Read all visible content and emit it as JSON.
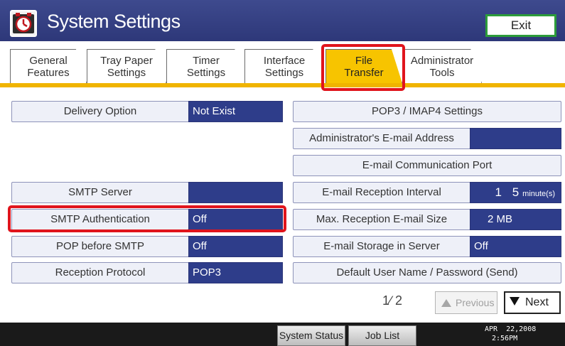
{
  "window": {
    "title": "System Settings",
    "exit_label": "Exit"
  },
  "tabs": [
    {
      "line1": "General",
      "line2": "Features",
      "active": false
    },
    {
      "line1": "Tray Paper",
      "line2": "Settings",
      "active": false
    },
    {
      "line1": "Timer",
      "line2": "Settings",
      "active": false
    },
    {
      "line1": "Interface",
      "line2": "Settings",
      "active": false
    },
    {
      "line1": "File",
      "line2": "Transfer",
      "active": true
    },
    {
      "line1": "Administrator",
      "line2": "Tools",
      "active": false
    }
  ],
  "left_settings": [
    {
      "label": "Delivery Option",
      "value": "Not Exist"
    },
    {
      "label": "SMTP Server",
      "value": ""
    },
    {
      "label": "SMTP Authentication",
      "value": "Off"
    },
    {
      "label": "POP before SMTP",
      "value": "Off"
    },
    {
      "label": "Reception Protocol",
      "value": "POP3"
    }
  ],
  "right_settings": [
    {
      "label": "POP3 / IMAP4 Settings"
    },
    {
      "label": "Administrator's E-mail Address",
      "value": ""
    },
    {
      "label": "E-mail Communication Port"
    },
    {
      "label": "E-mail Reception Interval",
      "value": "1 5",
      "unit": "minute(s)"
    },
    {
      "label": "Max. Reception E-mail Size",
      "value": "2 MB"
    },
    {
      "label": "E-mail Storage in Server",
      "value": "Off"
    },
    {
      "label": "Default User Name / Password (Send)"
    }
  ],
  "paging": {
    "indicator": "1∕ 2",
    "previous_label": "Previous",
    "next_label": "Next",
    "current": 1,
    "total": 2
  },
  "bottom": {
    "system_status_label": "System Status",
    "job_list_label": "Job List",
    "date": "APR  22,2008",
    "time": "2:56PM"
  },
  "colors": {
    "title_bar": "#2b3576",
    "active_tab": "#f7c400",
    "value_box": "#2e3d8a",
    "highlight": "#e0141c"
  }
}
